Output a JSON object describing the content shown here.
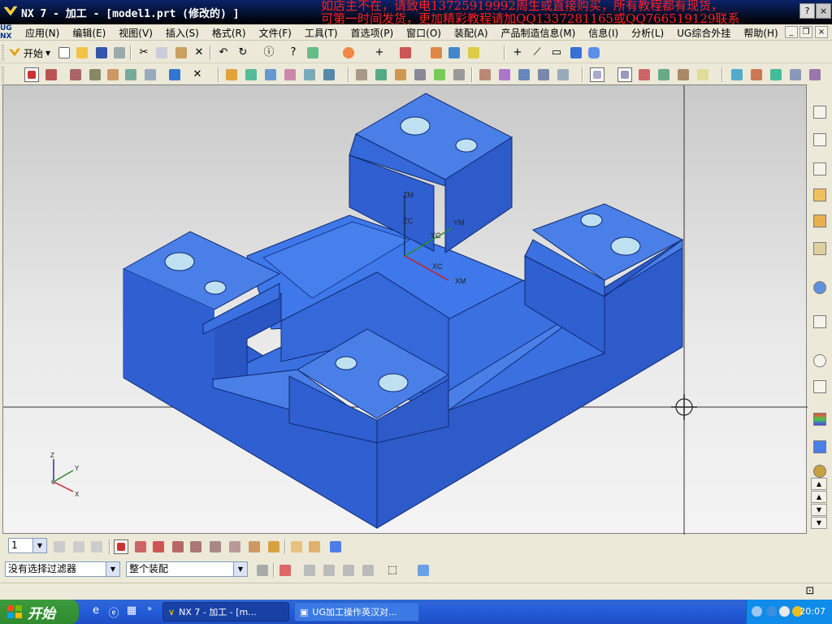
{
  "window": {
    "title": "NX 7 - 加工 - [model1.prt  (修改的) ]",
    "promo_line1": "如店主不在，请致电13725919992周生或直接购买，所有教程都有现货，",
    "promo_line2": "可第一时间发货，更加精彩教程请加QQ1337281165或QQ766519129联系",
    "help_button": "?",
    "close_button": "×"
  },
  "menubar": {
    "logo": "UG\nNX",
    "items": [
      "应用(N)",
      "编辑(E)",
      "视图(V)",
      "插入(S)",
      "格式(R)",
      "文件(F)",
      "工具(T)",
      "首选项(P)",
      "窗口(O)",
      "装配(A)",
      "产品制造信息(M)",
      "信息(I)",
      "分析(L)",
      "UG综合外挂",
      "帮助(H)"
    ],
    "minimize": "_",
    "restore": "❐",
    "close": "×"
  },
  "toolbar1": {
    "start_label": "开始"
  },
  "viewport": {
    "wcs_labels": {
      "zm": "ZM",
      "zc": "ZC",
      "ym": "YM",
      "xc": "XC",
      "yc": "YC",
      "xm": "XM"
    },
    "triad_labels": {
      "z": "Z",
      "y": "Y",
      "x": "X"
    }
  },
  "bottombar": {
    "layer_value": "1",
    "filter_value": "没有选择过滤器",
    "scope_value": "整个装配"
  },
  "taskbar": {
    "start_label": "开始",
    "tasks": [
      {
        "label": "NX 7 - 加工 - [m..."
      },
      {
        "label": "UG加工操作英汉对..."
      }
    ],
    "clock": "20:07"
  },
  "colors": {
    "part_top": "#4a7fe8",
    "part_side": "#2f5fd0",
    "part_dark": "#2450bb",
    "hole": "#bfe0f0"
  }
}
